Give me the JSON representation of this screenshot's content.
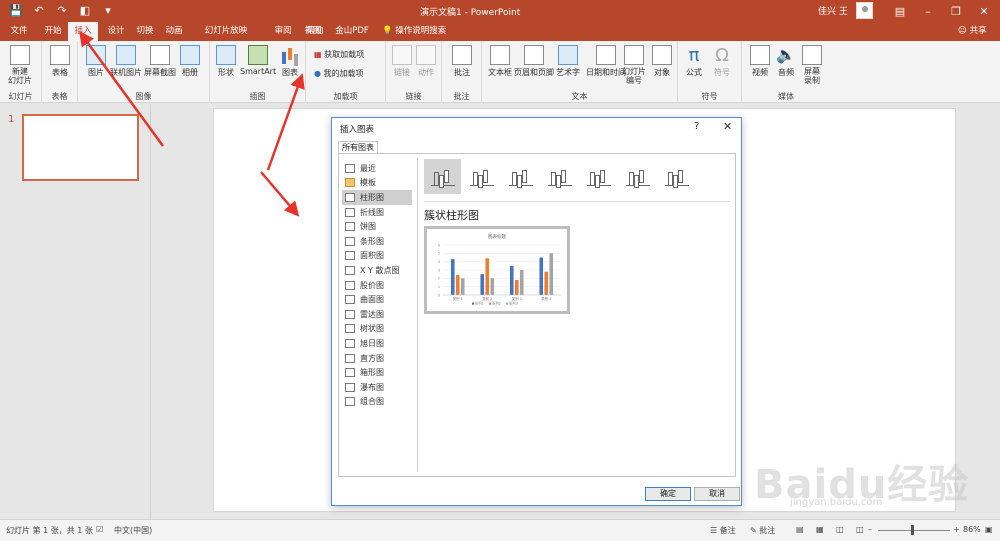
{
  "window": {
    "title": "演示文稿1 - PowerPoint",
    "user": "佳兴 王"
  },
  "qat": [
    "save-icon",
    "undo-icon",
    "redo-icon",
    "present-icon",
    "customize-icon"
  ],
  "tabs": [
    {
      "label": "文件"
    },
    {
      "label": "开始"
    },
    {
      "label": "插入",
      "active": true
    },
    {
      "label": "设计"
    },
    {
      "label": "切换"
    },
    {
      "label": "动画"
    },
    {
      "label": "幻灯片放映"
    },
    {
      "label": "审阅"
    },
    {
      "label": "视图"
    },
    {
      "label": "帮助"
    },
    {
      "label": "金山PDF"
    }
  ],
  "tellme": "操作说明搜索",
  "share": "共享",
  "ribbon": {
    "slides": {
      "new_slide": "新建\n幻灯片",
      "label": "幻灯片"
    },
    "tables": {
      "table": "表格",
      "label": "表格"
    },
    "images": {
      "picture": "图片",
      "online_picture": "联机图片",
      "screenshot": "屏幕截图",
      "album": "相册",
      "label": "图像"
    },
    "illustrations": {
      "shapes": "形状",
      "smartart": "SmartArt",
      "chart": "图表",
      "label": "插图"
    },
    "addins": {
      "get": "获取加载项",
      "my": "我的加载项",
      "label": "加载项"
    },
    "links": {
      "link": "链接",
      "action": "动作",
      "label": "链接"
    },
    "comments": {
      "comment": "批注",
      "label": "批注"
    },
    "text": {
      "textbox": "文本框",
      "header_footer": "页眉和页脚",
      "wordart": "艺术字",
      "datetime": "日期和时间",
      "slide_number": "幻灯片\n编号",
      "object": "对象",
      "label": "文本"
    },
    "symbols": {
      "equation": "公式",
      "symbol": "符号",
      "label": "符号"
    },
    "media": {
      "video": "视频",
      "audio": "音频",
      "screen_record": "屏幕\n录制",
      "label": "媒体"
    }
  },
  "thumbnail": {
    "number": "1"
  },
  "dialog": {
    "title": "插入图表",
    "help": "?",
    "tab": "所有图表",
    "categories": [
      {
        "label": "最近",
        "icon": "recent-icon"
      },
      {
        "label": "模板",
        "icon": "folder-icon"
      },
      {
        "label": "柱形图",
        "icon": "column-chart-icon",
        "selected": true
      },
      {
        "label": "折线图",
        "icon": "line-chart-icon"
      },
      {
        "label": "饼图",
        "icon": "pie-chart-icon"
      },
      {
        "label": "条形图",
        "icon": "bar-chart-icon"
      },
      {
        "label": "面积图",
        "icon": "area-chart-icon"
      },
      {
        "label": "X Y 散点图",
        "icon": "scatter-chart-icon"
      },
      {
        "label": "股价图",
        "icon": "stock-chart-icon"
      },
      {
        "label": "曲面图",
        "icon": "surface-chart-icon"
      },
      {
        "label": "雷达图",
        "icon": "radar-chart-icon"
      },
      {
        "label": "树状图",
        "icon": "treemap-chart-icon"
      },
      {
        "label": "旭日图",
        "icon": "sunburst-chart-icon"
      },
      {
        "label": "直方图",
        "icon": "histogram-chart-icon"
      },
      {
        "label": "箱形图",
        "icon": "box-chart-icon"
      },
      {
        "label": "瀑布图",
        "icon": "waterfall-chart-icon"
      },
      {
        "label": "组合图",
        "icon": "combo-chart-icon"
      }
    ],
    "subtypes": [
      {
        "icon": "clustered-column-icon",
        "selected": true
      },
      {
        "icon": "stacked-column-icon"
      },
      {
        "icon": "100-stacked-column-icon"
      },
      {
        "icon": "3d-clustered-column-icon"
      },
      {
        "icon": "3d-stacked-column-icon"
      },
      {
        "icon": "3d-100-stacked-column-icon"
      },
      {
        "icon": "3d-column-icon"
      }
    ],
    "subtype_name": "簇状柱形图",
    "ok": "确定",
    "cancel": "取消"
  },
  "chart_data": {
    "type": "bar",
    "title": "图表标题",
    "categories": [
      "类别 1",
      "类别 2",
      "类别 3",
      "类别 4"
    ],
    "series": [
      {
        "name": "系列1",
        "values": [
          4.3,
          2.5,
          3.5,
          4.5
        ],
        "color": "#4472c4"
      },
      {
        "name": "系列2",
        "values": [
          2.4,
          4.4,
          1.8,
          2.8
        ],
        "color": "#ed7d31"
      },
      {
        "name": "系列3",
        "values": [
          2,
          2,
          3,
          5
        ],
        "color": "#a5a5a5"
      }
    ],
    "yticks": [
      "6",
      "5",
      "4",
      "3",
      "2",
      "1",
      "0"
    ],
    "ylim": [
      0,
      6
    ],
    "legend": "bottom",
    "grid": true
  },
  "status": {
    "slide_info": "幻灯片 第 1 张，共 1 张",
    "language": "中文(中国)",
    "notes": "备注",
    "comments": "批注",
    "zoom": "86%"
  },
  "watermark": {
    "text": "Baidu经验",
    "url": "jingyan.baidu.com"
  }
}
